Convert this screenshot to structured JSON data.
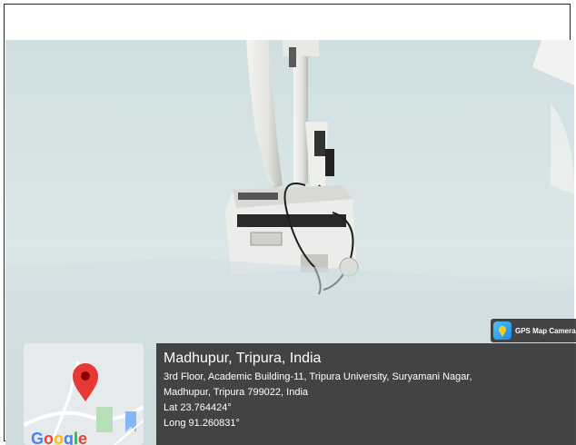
{
  "location": {
    "title": "Madhupur, Tripura, India",
    "address_line1": "3rd Floor, Academic Building-11, Tripura University, Suryamani Nagar,",
    "address_line2": "Madhupur, Tripura 799022, India",
    "lat": "Lat 23.764424°",
    "long": "Long 91.260831°"
  },
  "app_badge": {
    "label": "GPS Map Camera"
  },
  "map": {
    "logo_text": "Google",
    "pin_color": "#e53935"
  },
  "photo": {
    "subject": "ceiling-mounted projector",
    "ceiling_color": "#d6e3e4",
    "projector_color": "#e9e9e6"
  }
}
